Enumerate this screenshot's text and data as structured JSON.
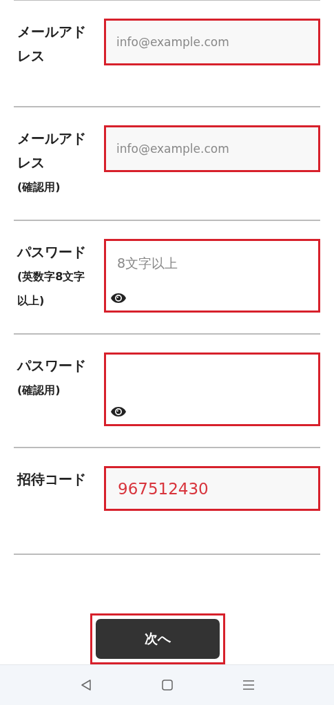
{
  "fields": [
    {
      "kind": "text",
      "label": "メールアドレス",
      "placeholder": "info@example.com",
      "highlighted": true
    },
    {
      "kind": "text",
      "label": "メールアドレス",
      "note": "(確認用)",
      "placeholder": "info@example.com",
      "highlighted": true
    },
    {
      "kind": "password",
      "label": "パスワード",
      "note": "(英数字8文字以上)",
      "placeholder": "8文字以上",
      "highlighted": true
    },
    {
      "kind": "password",
      "label": "パスワード",
      "note": "(確認用)",
      "highlighted": true
    },
    {
      "kind": "code",
      "label": "招待コード",
      "value": "967512430",
      "highlighted": true
    }
  ],
  "next_button": {
    "label": "次へ",
    "highlighted": true
  }
}
